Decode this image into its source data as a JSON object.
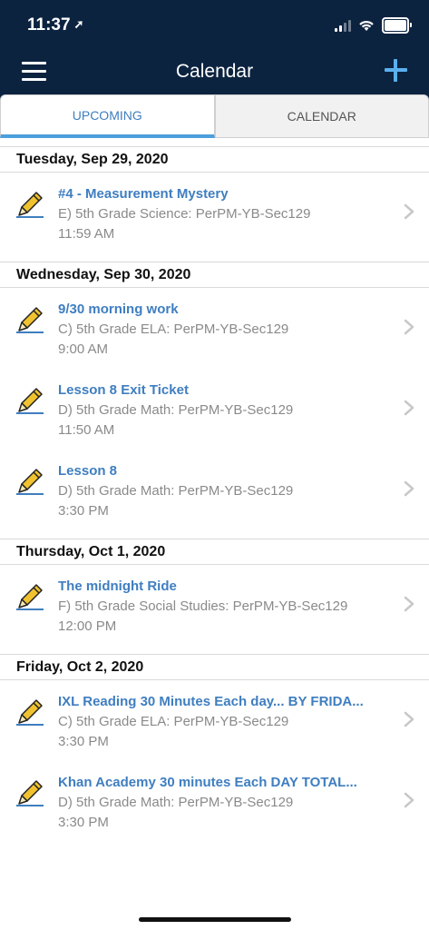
{
  "status": {
    "time": "11:37",
    "arrow": "➚"
  },
  "header": {
    "title": "Calendar"
  },
  "tabs": {
    "upcoming": "UPCOMING",
    "calendar": "CALENDAR"
  },
  "days": [
    {
      "label": "Tuesday, Sep 29, 2020",
      "events": [
        {
          "title": "#4 - Measurement Mystery",
          "course": "E) 5th Grade Science: PerPM-YB-Sec129",
          "time": "11:59 AM"
        }
      ]
    },
    {
      "label": "Wednesday, Sep 30, 2020",
      "events": [
        {
          "title": "9/30 morning work",
          "course": "C) 5th Grade ELA: PerPM-YB-Sec129",
          "time": "9:00 AM"
        },
        {
          "title": "Lesson 8 Exit Ticket",
          "course": "D) 5th Grade Math: PerPM-YB-Sec129",
          "time": "11:50 AM"
        },
        {
          "title": "Lesson 8",
          "course": "D) 5th Grade Math: PerPM-YB-Sec129",
          "time": "3:30 PM"
        }
      ]
    },
    {
      "label": "Thursday, Oct 1, 2020",
      "events": [
        {
          "title": "The midnight Ride",
          "course": "F) 5th Grade Social Studies: PerPM-YB-Sec129",
          "time": "12:00 PM"
        }
      ]
    },
    {
      "label": "Friday, Oct 2, 2020",
      "events": [
        {
          "title": "IXL Reading 30 Minutes Each day... BY FRIDA...",
          "course": "C) 5th Grade ELA: PerPM-YB-Sec129",
          "time": "3:30 PM"
        },
        {
          "title": "Khan Academy 30 minutes Each DAY  TOTAL...",
          "course": "D) 5th Grade Math: PerPM-YB-Sec129",
          "time": "3:30 PM"
        }
      ]
    }
  ],
  "colors": {
    "nav": "#0c2340",
    "accent": "#3f7ec0",
    "pencil": "#f0c230"
  }
}
